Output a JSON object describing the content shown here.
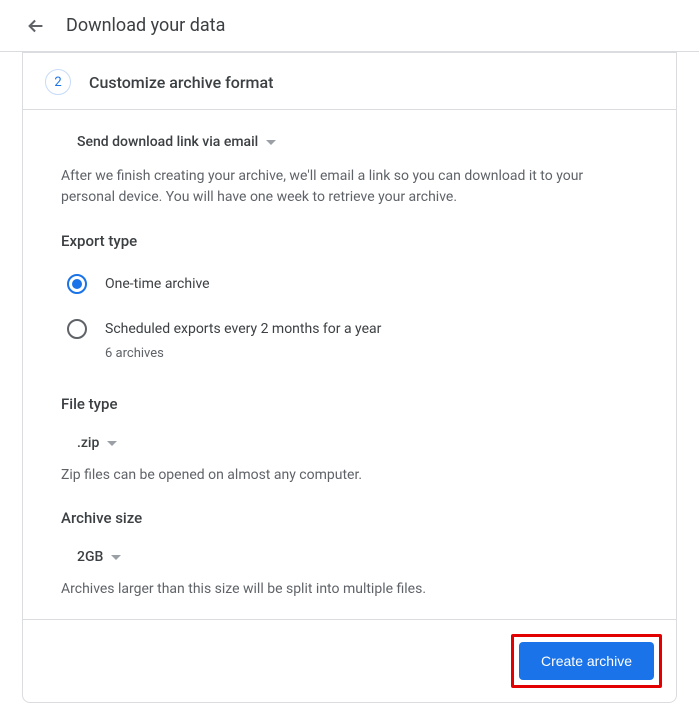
{
  "header": {
    "title": "Download your data"
  },
  "step": {
    "number": "2",
    "title": "Customize archive format"
  },
  "deliveryMethod": {
    "selected": "Send download link via email",
    "description": "After we finish creating your archive, we'll email a link so you can download it to your personal device. You will have one week to retrieve your archive."
  },
  "exportType": {
    "title": "Export type",
    "options": [
      {
        "label": "One-time archive",
        "selected": true
      },
      {
        "label": "Scheduled exports every 2 months for a year",
        "sublabel": "6 archives",
        "selected": false
      }
    ]
  },
  "fileType": {
    "title": "File type",
    "selected": ".zip",
    "help": "Zip files can be opened on almost any computer."
  },
  "archiveSize": {
    "title": "Archive size",
    "selected": "2GB",
    "help": "Archives larger than this size will be split into multiple files."
  },
  "footer": {
    "createButton": "Create archive"
  }
}
